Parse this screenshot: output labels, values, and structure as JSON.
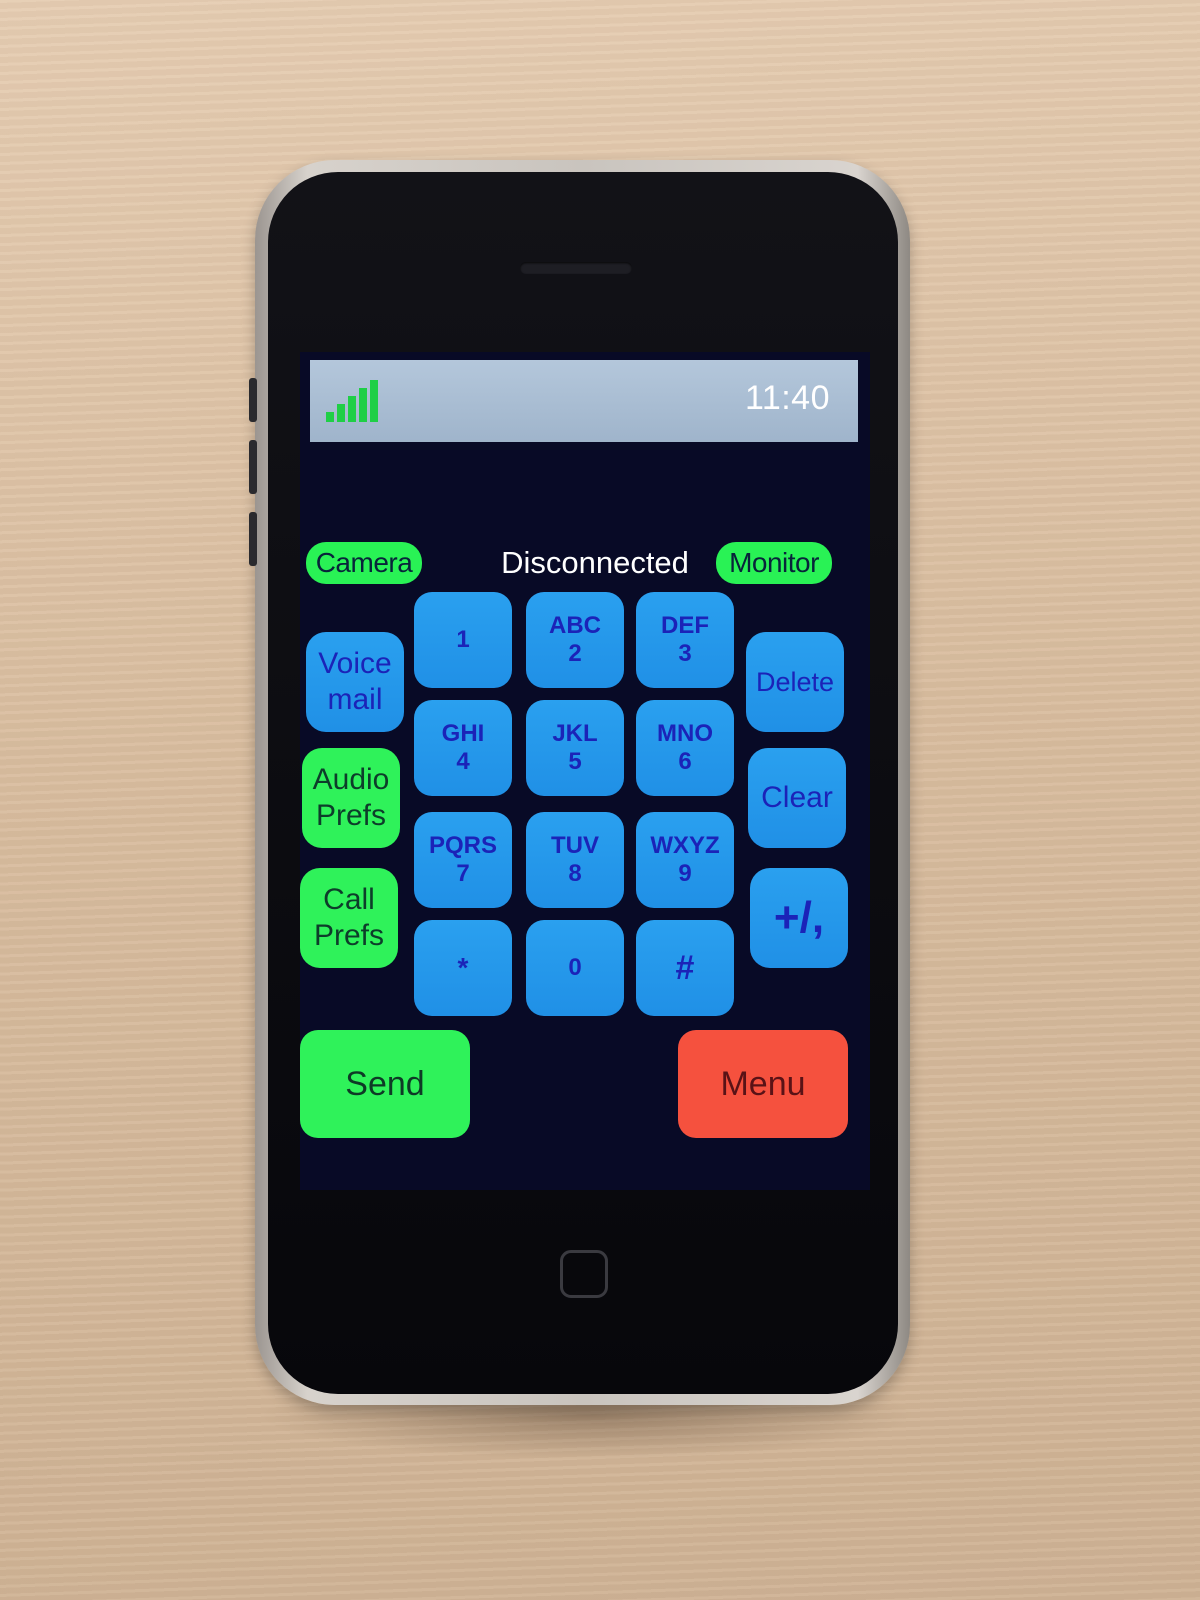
{
  "status_bar": {
    "time": "11:40"
  },
  "top_row": {
    "camera_label": "Camera",
    "status": "Disconnected",
    "monitor_label": "Monitor"
  },
  "left_buttons": [
    {
      "line1": "Voice",
      "line2": "mail"
    },
    {
      "line1": "Audio",
      "line2": "Prefs"
    },
    {
      "line1": "Call",
      "line2": "Prefs"
    }
  ],
  "keypad": [
    {
      "letters": "",
      "digit": "1"
    },
    {
      "letters": "ABC",
      "digit": "2"
    },
    {
      "letters": "DEF",
      "digit": "3"
    },
    {
      "letters": "GHI",
      "digit": "4"
    },
    {
      "letters": "JKL",
      "digit": "5"
    },
    {
      "letters": "MNO",
      "digit": "6"
    },
    {
      "letters": "PQRS",
      "digit": "7"
    },
    {
      "letters": "TUV",
      "digit": "8"
    },
    {
      "letters": "WXYZ",
      "digit": "9"
    },
    {
      "letters": "",
      "digit": "*"
    },
    {
      "letters": "",
      "digit": "0"
    },
    {
      "letters": "",
      "digit": "#"
    }
  ],
  "right_buttons": {
    "delete_label": "Delete",
    "clear_label": "Clear",
    "plus_label": "+/,"
  },
  "bottom": {
    "send_label": "Send",
    "menu_label": "Menu"
  },
  "colors": {
    "keypad_blue": "#2a9cee",
    "action_green": "#2ff25a",
    "menu_red": "#f5513e",
    "screen_background": "#080a26"
  }
}
